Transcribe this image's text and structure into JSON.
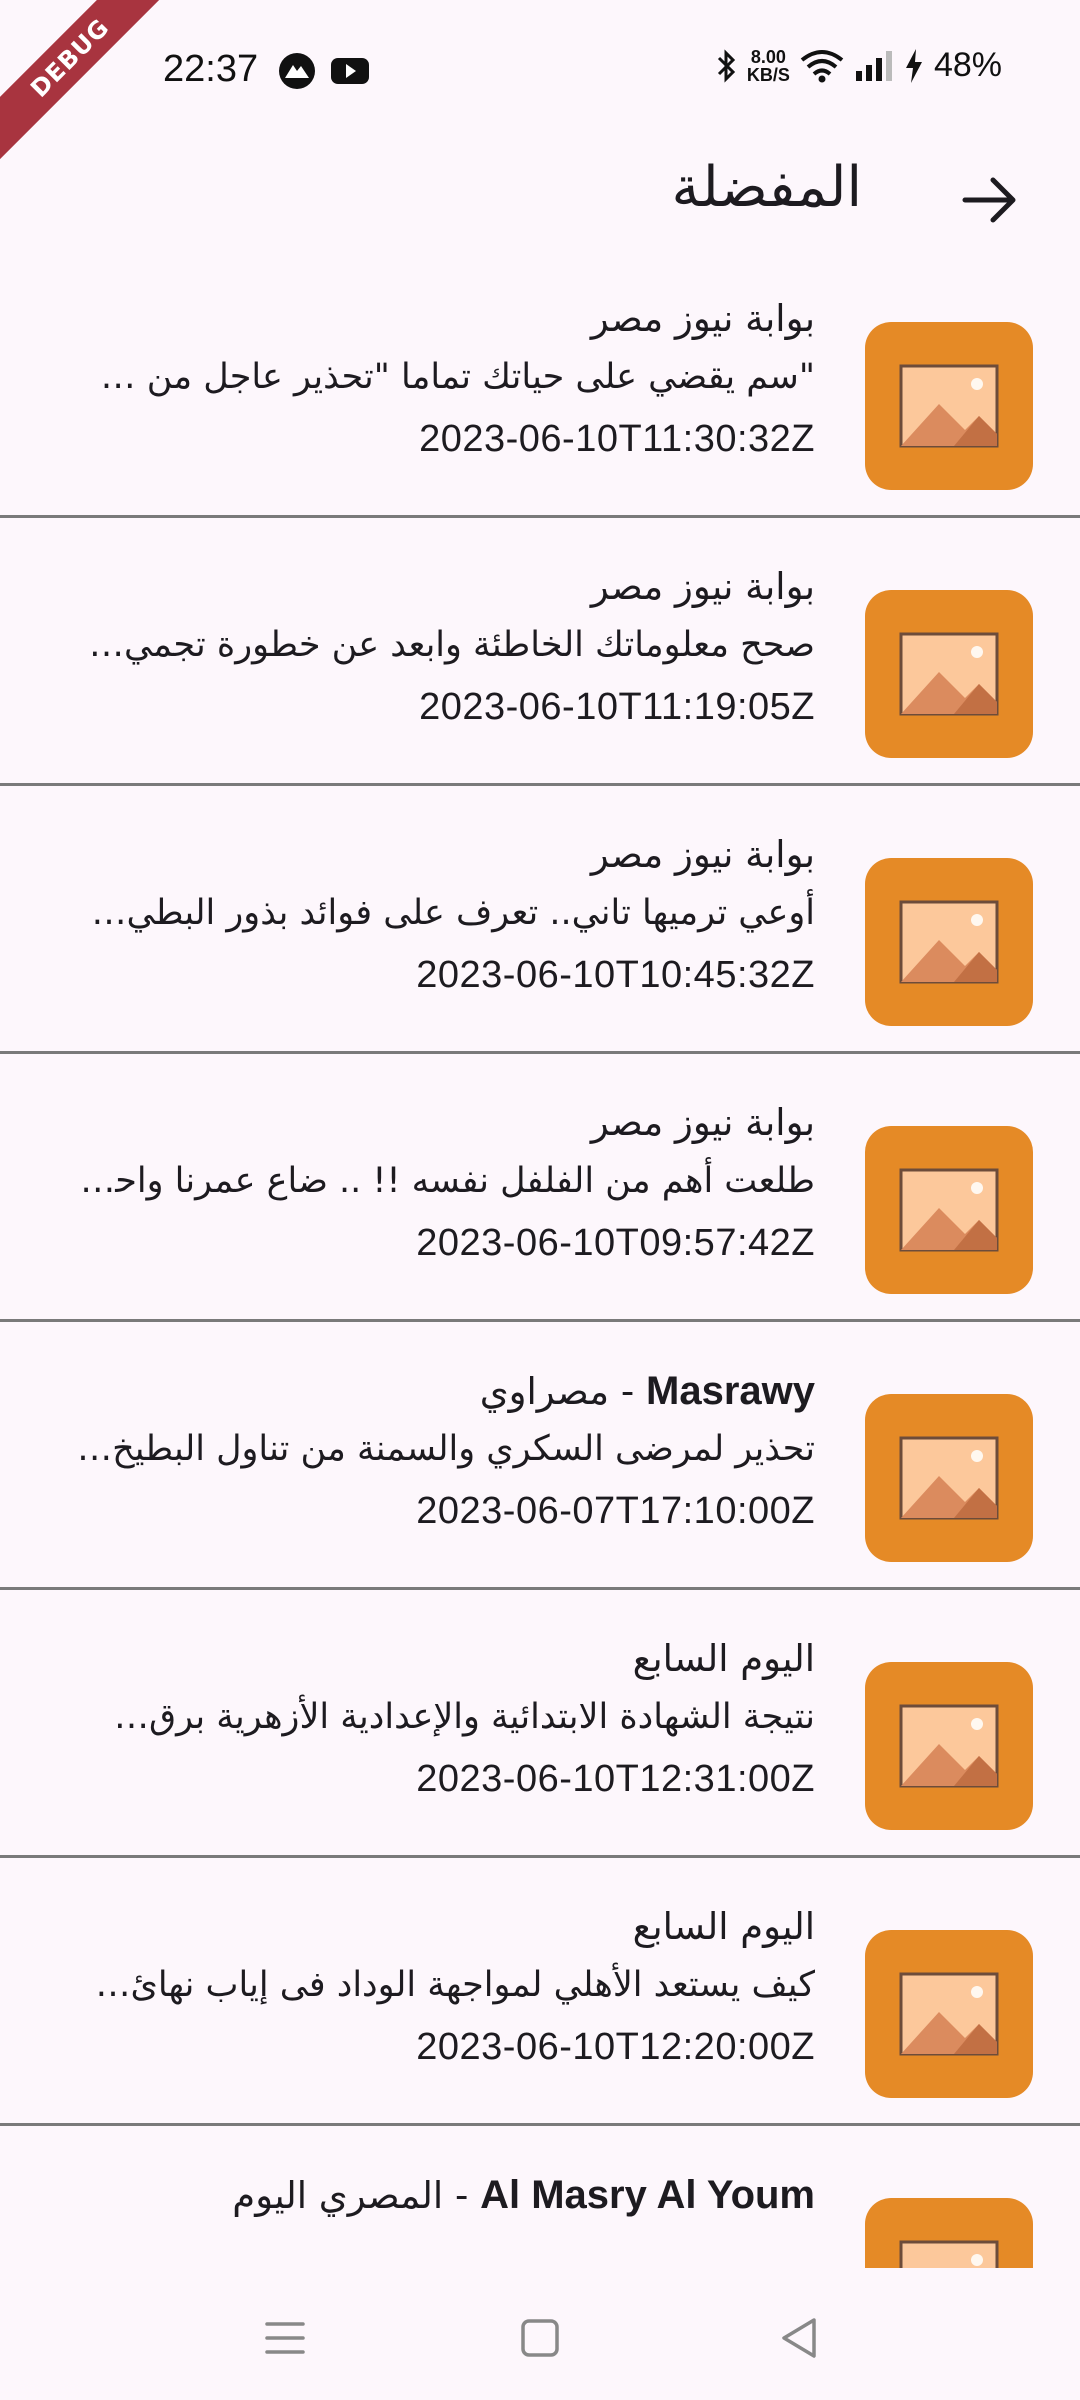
{
  "status_bar": {
    "time": "22:37",
    "net_speed_value": "8.00",
    "net_speed_unit": "KB/S",
    "battery": "48%",
    "debug_label": "DEBUG"
  },
  "app_bar": {
    "title": "المفضلة",
    "back_icon": "arrow-right-icon"
  },
  "articles": [
    {
      "source": "بوابة نيوز مصر",
      "title": "\"سم يقضي على حياتك تماما \"تحذير عاجل من …",
      "date": "2023-06-10T11:30:32Z"
    },
    {
      "source": "بوابة نيوز مصر",
      "title": "صحح معلوماتك الخاطئة وابعد عن خطورة تجمي…",
      "date": "2023-06-10T11:19:05Z"
    },
    {
      "source": "بوابة نيوز مصر",
      "title": "أوعي ترميها تاني.. تعرف على فوائد بذور البطي…",
      "date": "2023-06-10T10:45:32Z"
    },
    {
      "source": "بوابة نيوز مصر",
      "title": "طلعت أهم من الفلفل نفسه !! .. ضاع عمرنا واحن…",
      "date": "2023-06-10T09:57:42Z"
    },
    {
      "source_latin": "Masrawy",
      "source_sep": " - ",
      "source_ar": "مصراوي",
      "title": "تحذير لمرضى السكري والسمنة من تناول البطيخ…",
      "date": "2023-06-07T17:10:00Z"
    },
    {
      "source": "اليوم السابع",
      "title": "نتيجة الشهادة الابتدائية والإعدادية الأزهرية برق…",
      "date": "2023-06-10T12:31:00Z"
    },
    {
      "source": "اليوم السابع",
      "title": "كيف يستعد الأهلي لمواجهة الوداد فى إياب نهائ…",
      "date": "2023-06-10T12:20:00Z"
    },
    {
      "source_latin": "Al Masry Al Youm",
      "source_sep": " - ",
      "source_ar": "المصري اليوم",
      "title": "",
      "date": ""
    }
  ],
  "colors": {
    "thumb_bg": "#e58a26",
    "background": "#fdf7fc",
    "divider": "#7a7a7a",
    "debug_banner": "#a8343f"
  },
  "nav": {
    "recents_icon": "menu-lines-icon",
    "home_icon": "square-home-icon",
    "back_icon": "triangle-back-icon"
  }
}
